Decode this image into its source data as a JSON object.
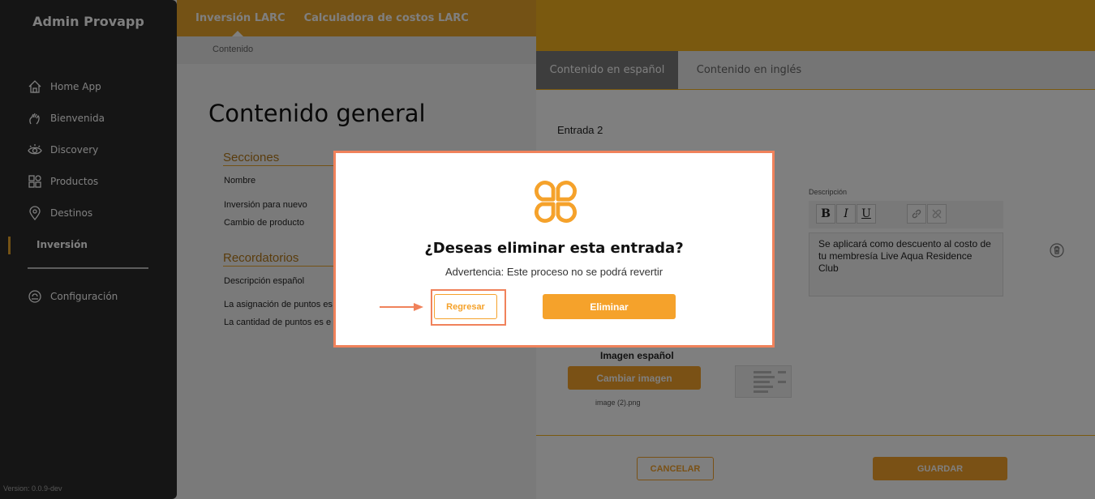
{
  "sidebar": {
    "app_title": "Admin Provapp",
    "items": [
      {
        "label": "Home App",
        "icon": "home-icon"
      },
      {
        "label": "Bienvenida",
        "icon": "hand-icon"
      },
      {
        "label": "Discovery",
        "icon": "eye-icon"
      },
      {
        "label": "Productos",
        "icon": "grid-icon"
      },
      {
        "label": "Destinos",
        "icon": "location-pin-icon"
      },
      {
        "label": "Inversión",
        "icon": ""
      },
      {
        "label": "Configuración",
        "icon": "settings-icon"
      }
    ],
    "active_item": "Inversión",
    "version": "Version: 0.0.9-dev"
  },
  "topbar": {
    "tabs": [
      "Inversión LARC",
      "Calculadora de costos LARC"
    ]
  },
  "breadcrumb": "Contenido",
  "main": {
    "title": "Contenido general",
    "sections": {
      "secciones": "Secciones",
      "nombre_header": "Nombre",
      "rows": [
        "Inversión para nuevo",
        "Cambio de producto"
      ],
      "recordatorios": "Recordatorios",
      "descripcion_header": "Descripción español",
      "reminder_rows": [
        "La asignación de puntos es",
        "La cantidad de puntos es e"
      ]
    }
  },
  "panel": {
    "tabs": [
      "Contenido en español",
      "Contenido en inglés"
    ],
    "active_tab": "Contenido en español",
    "entry_label": "Entrada 2",
    "description_label": "Descripción",
    "toolbar": {
      "bold": "B",
      "italic": "I",
      "underline": "U"
    },
    "description_text": "Se aplicará como descuento al costo de tu membresía Live Aqua Residence Club",
    "image_label": "Imagen español",
    "change_image_button": "Cambiar imagen",
    "filename": "image (2).png",
    "cancel_button": "CANCELAR",
    "save_button": "GUARDAR"
  },
  "dialog": {
    "title": "¿Deseas eliminar esta entrada?",
    "warning": "Advertencia: Este proceso no se podrá revertir",
    "back_button": "Regresar",
    "delete_button": "Eliminar"
  },
  "colors": {
    "accent": "#f5a22b",
    "brand_yellow": "#f5b21f",
    "highlight": "#f0825b",
    "sidebar": "#2a2a2a"
  }
}
